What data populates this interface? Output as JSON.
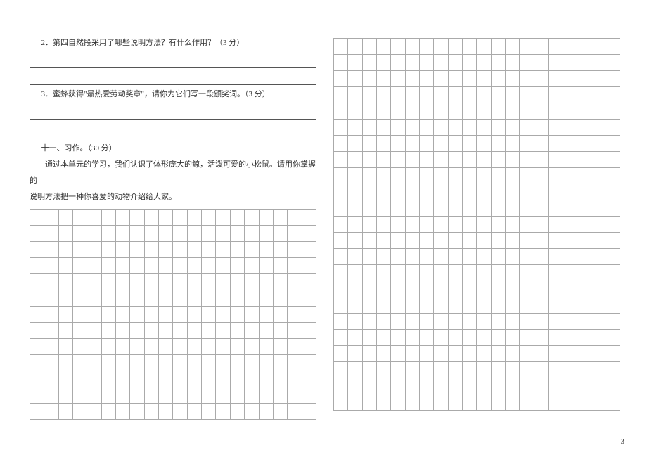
{
  "left": {
    "q2": "2．第四自然段采用了哪些说明方法？有什么作用？（3 分）",
    "q3": "3．蜜蜂获得\"最热爱劳动奖章\"，请你为它们写一段颁奖词。（3 分）",
    "section_heading": "十一、习作。（30 分）",
    "para1": "通过本单元的学习，我们认识了体形庞大的鲸，活泼可爱的小松鼠。请用你掌握的",
    "para2": "说明方法把一种你喜爱的动物介绍给大家。"
  },
  "grid": {
    "cols": 20,
    "left_top_rows": 0,
    "left_bottom_rows": 13,
    "right_rows": 23
  },
  "page_number": "3"
}
